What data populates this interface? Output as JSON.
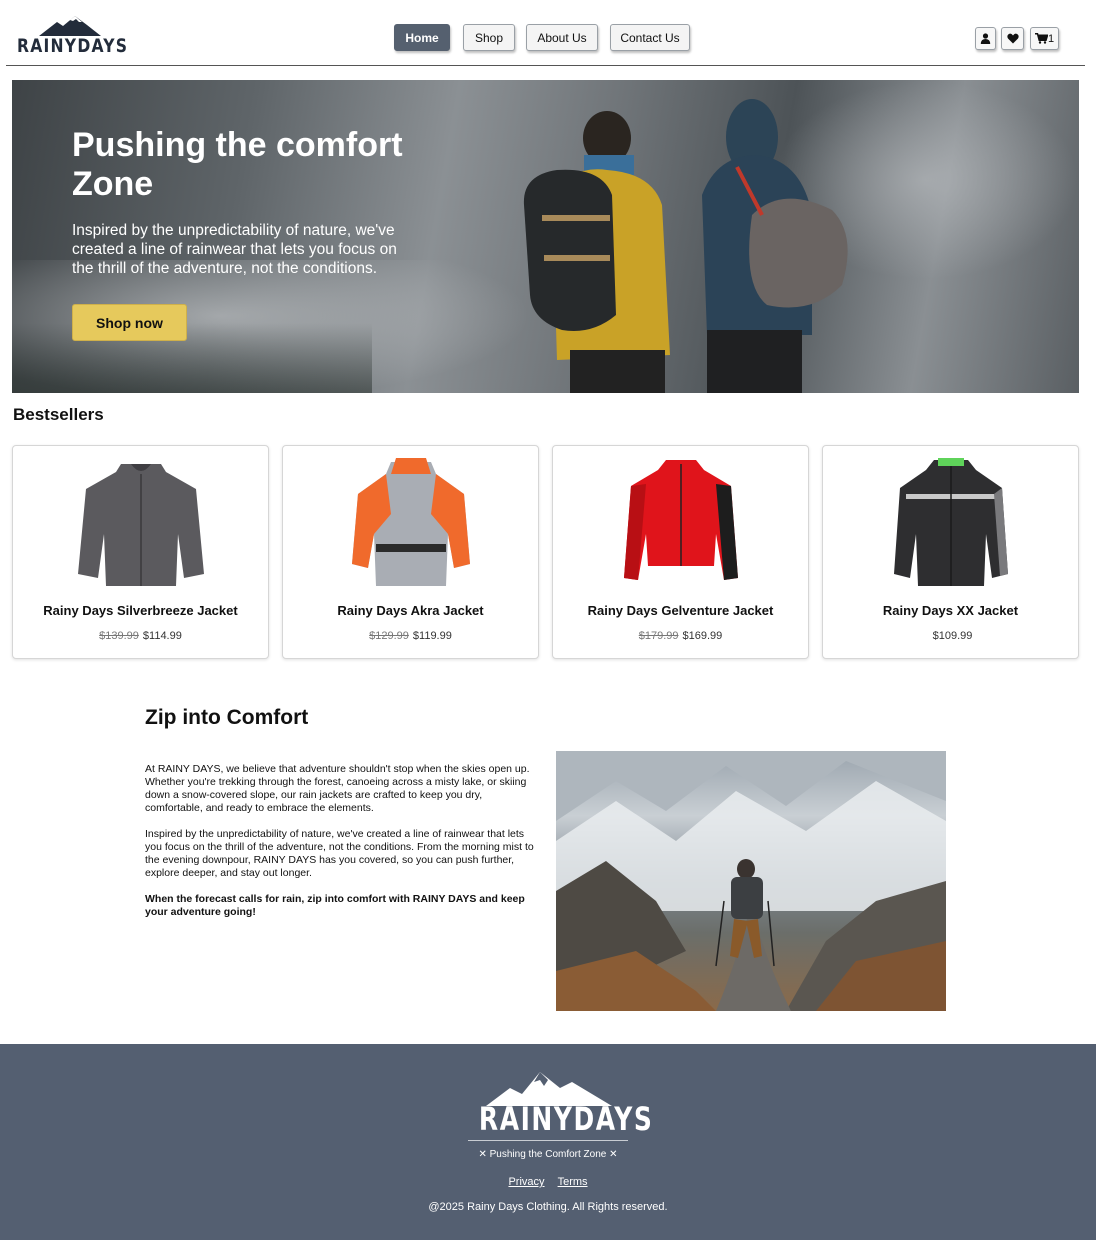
{
  "header": {
    "logo_text": "RAINYDAYS",
    "nav": [
      "Home",
      "Shop",
      "About Us",
      "Contact Us"
    ],
    "active_nav": "Home",
    "cart_count": "1"
  },
  "hero": {
    "title": "Pushing the comfort Zone",
    "text": "Inspired by the unpredictability of nature, we've created a line of rainwear that lets you focus on the thrill of the adventure, not the conditions.",
    "cta": "Shop now"
  },
  "bestsellers": {
    "title": "Bestsellers",
    "products": [
      {
        "name": "Rainy Days Silverbreeze Jacket",
        "old_price": "$139.99",
        "price": "$114.99",
        "color": "#5b5a5e"
      },
      {
        "name": "Rainy Days Akra Jacket",
        "old_price": "$129.99",
        "price": "$119.99",
        "color": "#f06a2c"
      },
      {
        "name": "Rainy Days Gelventure Jacket",
        "old_price": "$179.99",
        "price": "$169.99",
        "color": "#e0141b"
      },
      {
        "name": "Rainy Days XX Jacket",
        "old_price": "",
        "price": "$109.99",
        "color": "#2e2e30"
      }
    ]
  },
  "zip": {
    "title": "Zip into Comfort",
    "p1": "At RAINY DAYS, we believe that adventure shouldn't stop when the skies open up. Whether you're trekking through the forest, canoeing across a misty lake, or skiing down a snow-covered slope, our rain jackets are crafted to keep you dry, comfortable, and ready to embrace the elements.",
    "p2": "Inspired by the unpredictability of nature, we've created a line of rainwear that lets you focus on the thrill of the adventure, not the conditions. From the morning mist to the evening downpour, RAINY DAYS has you covered, so you can push further, explore deeper, and stay out longer.",
    "p3": "When the forecast calls for rain, zip into comfort with RAINY DAYS and keep your adventure going!"
  },
  "footer": {
    "logo_text": "RAINYDAYS",
    "tagline": "✕ Pushing the Comfort Zone ✕",
    "links": [
      "Privacy",
      "Terms"
    ],
    "copyright": "@2025 Rainy Days Clothing. All Rights reserved."
  },
  "colors": {
    "nav_active": "#55606f",
    "cta": "#e6c95c",
    "footer_bg": "#545f71"
  }
}
